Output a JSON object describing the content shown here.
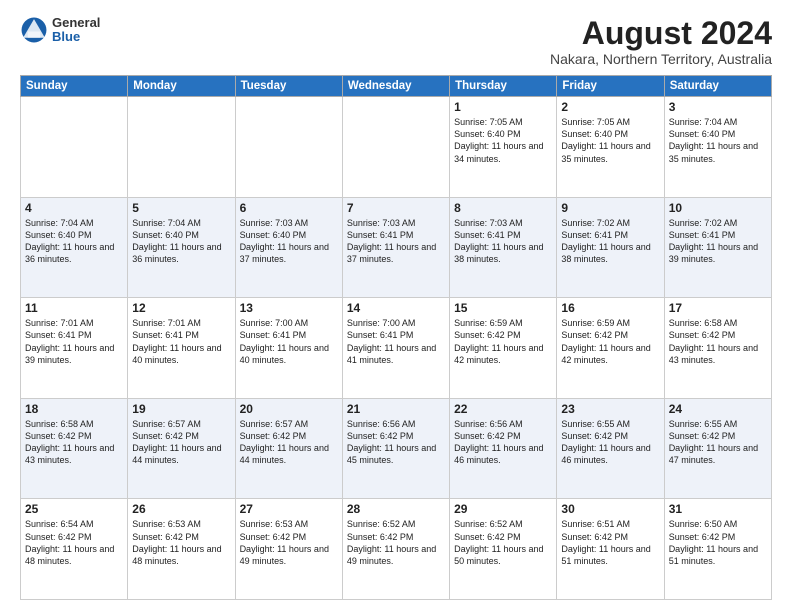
{
  "logo": {
    "general": "General",
    "blue": "Blue"
  },
  "header": {
    "title": "August 2024",
    "subtitle": "Nakara, Northern Territory, Australia"
  },
  "days_of_week": [
    "Sunday",
    "Monday",
    "Tuesday",
    "Wednesday",
    "Thursday",
    "Friday",
    "Saturday"
  ],
  "weeks": [
    [
      {
        "num": "",
        "info": ""
      },
      {
        "num": "",
        "info": ""
      },
      {
        "num": "",
        "info": ""
      },
      {
        "num": "",
        "info": ""
      },
      {
        "num": "1",
        "info": "Sunrise: 7:05 AM\nSunset: 6:40 PM\nDaylight: 11 hours\nand 34 minutes."
      },
      {
        "num": "2",
        "info": "Sunrise: 7:05 AM\nSunset: 6:40 PM\nDaylight: 11 hours\nand 35 minutes."
      },
      {
        "num": "3",
        "info": "Sunrise: 7:04 AM\nSunset: 6:40 PM\nDaylight: 11 hours\nand 35 minutes."
      }
    ],
    [
      {
        "num": "4",
        "info": "Sunrise: 7:04 AM\nSunset: 6:40 PM\nDaylight: 11 hours\nand 36 minutes."
      },
      {
        "num": "5",
        "info": "Sunrise: 7:04 AM\nSunset: 6:40 PM\nDaylight: 11 hours\nand 36 minutes."
      },
      {
        "num": "6",
        "info": "Sunrise: 7:03 AM\nSunset: 6:40 PM\nDaylight: 11 hours\nand 37 minutes."
      },
      {
        "num": "7",
        "info": "Sunrise: 7:03 AM\nSunset: 6:41 PM\nDaylight: 11 hours\nand 37 minutes."
      },
      {
        "num": "8",
        "info": "Sunrise: 7:03 AM\nSunset: 6:41 PM\nDaylight: 11 hours\nand 38 minutes."
      },
      {
        "num": "9",
        "info": "Sunrise: 7:02 AM\nSunset: 6:41 PM\nDaylight: 11 hours\nand 38 minutes."
      },
      {
        "num": "10",
        "info": "Sunrise: 7:02 AM\nSunset: 6:41 PM\nDaylight: 11 hours\nand 39 minutes."
      }
    ],
    [
      {
        "num": "11",
        "info": "Sunrise: 7:01 AM\nSunset: 6:41 PM\nDaylight: 11 hours\nand 39 minutes."
      },
      {
        "num": "12",
        "info": "Sunrise: 7:01 AM\nSunset: 6:41 PM\nDaylight: 11 hours\nand 40 minutes."
      },
      {
        "num": "13",
        "info": "Sunrise: 7:00 AM\nSunset: 6:41 PM\nDaylight: 11 hours\nand 40 minutes."
      },
      {
        "num": "14",
        "info": "Sunrise: 7:00 AM\nSunset: 6:41 PM\nDaylight: 11 hours\nand 41 minutes."
      },
      {
        "num": "15",
        "info": "Sunrise: 6:59 AM\nSunset: 6:42 PM\nDaylight: 11 hours\nand 42 minutes."
      },
      {
        "num": "16",
        "info": "Sunrise: 6:59 AM\nSunset: 6:42 PM\nDaylight: 11 hours\nand 42 minutes."
      },
      {
        "num": "17",
        "info": "Sunrise: 6:58 AM\nSunset: 6:42 PM\nDaylight: 11 hours\nand 43 minutes."
      }
    ],
    [
      {
        "num": "18",
        "info": "Sunrise: 6:58 AM\nSunset: 6:42 PM\nDaylight: 11 hours\nand 43 minutes."
      },
      {
        "num": "19",
        "info": "Sunrise: 6:57 AM\nSunset: 6:42 PM\nDaylight: 11 hours\nand 44 minutes."
      },
      {
        "num": "20",
        "info": "Sunrise: 6:57 AM\nSunset: 6:42 PM\nDaylight: 11 hours\nand 44 minutes."
      },
      {
        "num": "21",
        "info": "Sunrise: 6:56 AM\nSunset: 6:42 PM\nDaylight: 11 hours\nand 45 minutes."
      },
      {
        "num": "22",
        "info": "Sunrise: 6:56 AM\nSunset: 6:42 PM\nDaylight: 11 hours\nand 46 minutes."
      },
      {
        "num": "23",
        "info": "Sunrise: 6:55 AM\nSunset: 6:42 PM\nDaylight: 11 hours\nand 46 minutes."
      },
      {
        "num": "24",
        "info": "Sunrise: 6:55 AM\nSunset: 6:42 PM\nDaylight: 11 hours\nand 47 minutes."
      }
    ],
    [
      {
        "num": "25",
        "info": "Sunrise: 6:54 AM\nSunset: 6:42 PM\nDaylight: 11 hours\nand 48 minutes."
      },
      {
        "num": "26",
        "info": "Sunrise: 6:53 AM\nSunset: 6:42 PM\nDaylight: 11 hours\nand 48 minutes."
      },
      {
        "num": "27",
        "info": "Sunrise: 6:53 AM\nSunset: 6:42 PM\nDaylight: 11 hours\nand 49 minutes."
      },
      {
        "num": "28",
        "info": "Sunrise: 6:52 AM\nSunset: 6:42 PM\nDaylight: 11 hours\nand 49 minutes."
      },
      {
        "num": "29",
        "info": "Sunrise: 6:52 AM\nSunset: 6:42 PM\nDaylight: 11 hours\nand 50 minutes."
      },
      {
        "num": "30",
        "info": "Sunrise: 6:51 AM\nSunset: 6:42 PM\nDaylight: 11 hours\nand 51 minutes."
      },
      {
        "num": "31",
        "info": "Sunrise: 6:50 AM\nSunset: 6:42 PM\nDaylight: 11 hours\nand 51 minutes."
      }
    ]
  ]
}
